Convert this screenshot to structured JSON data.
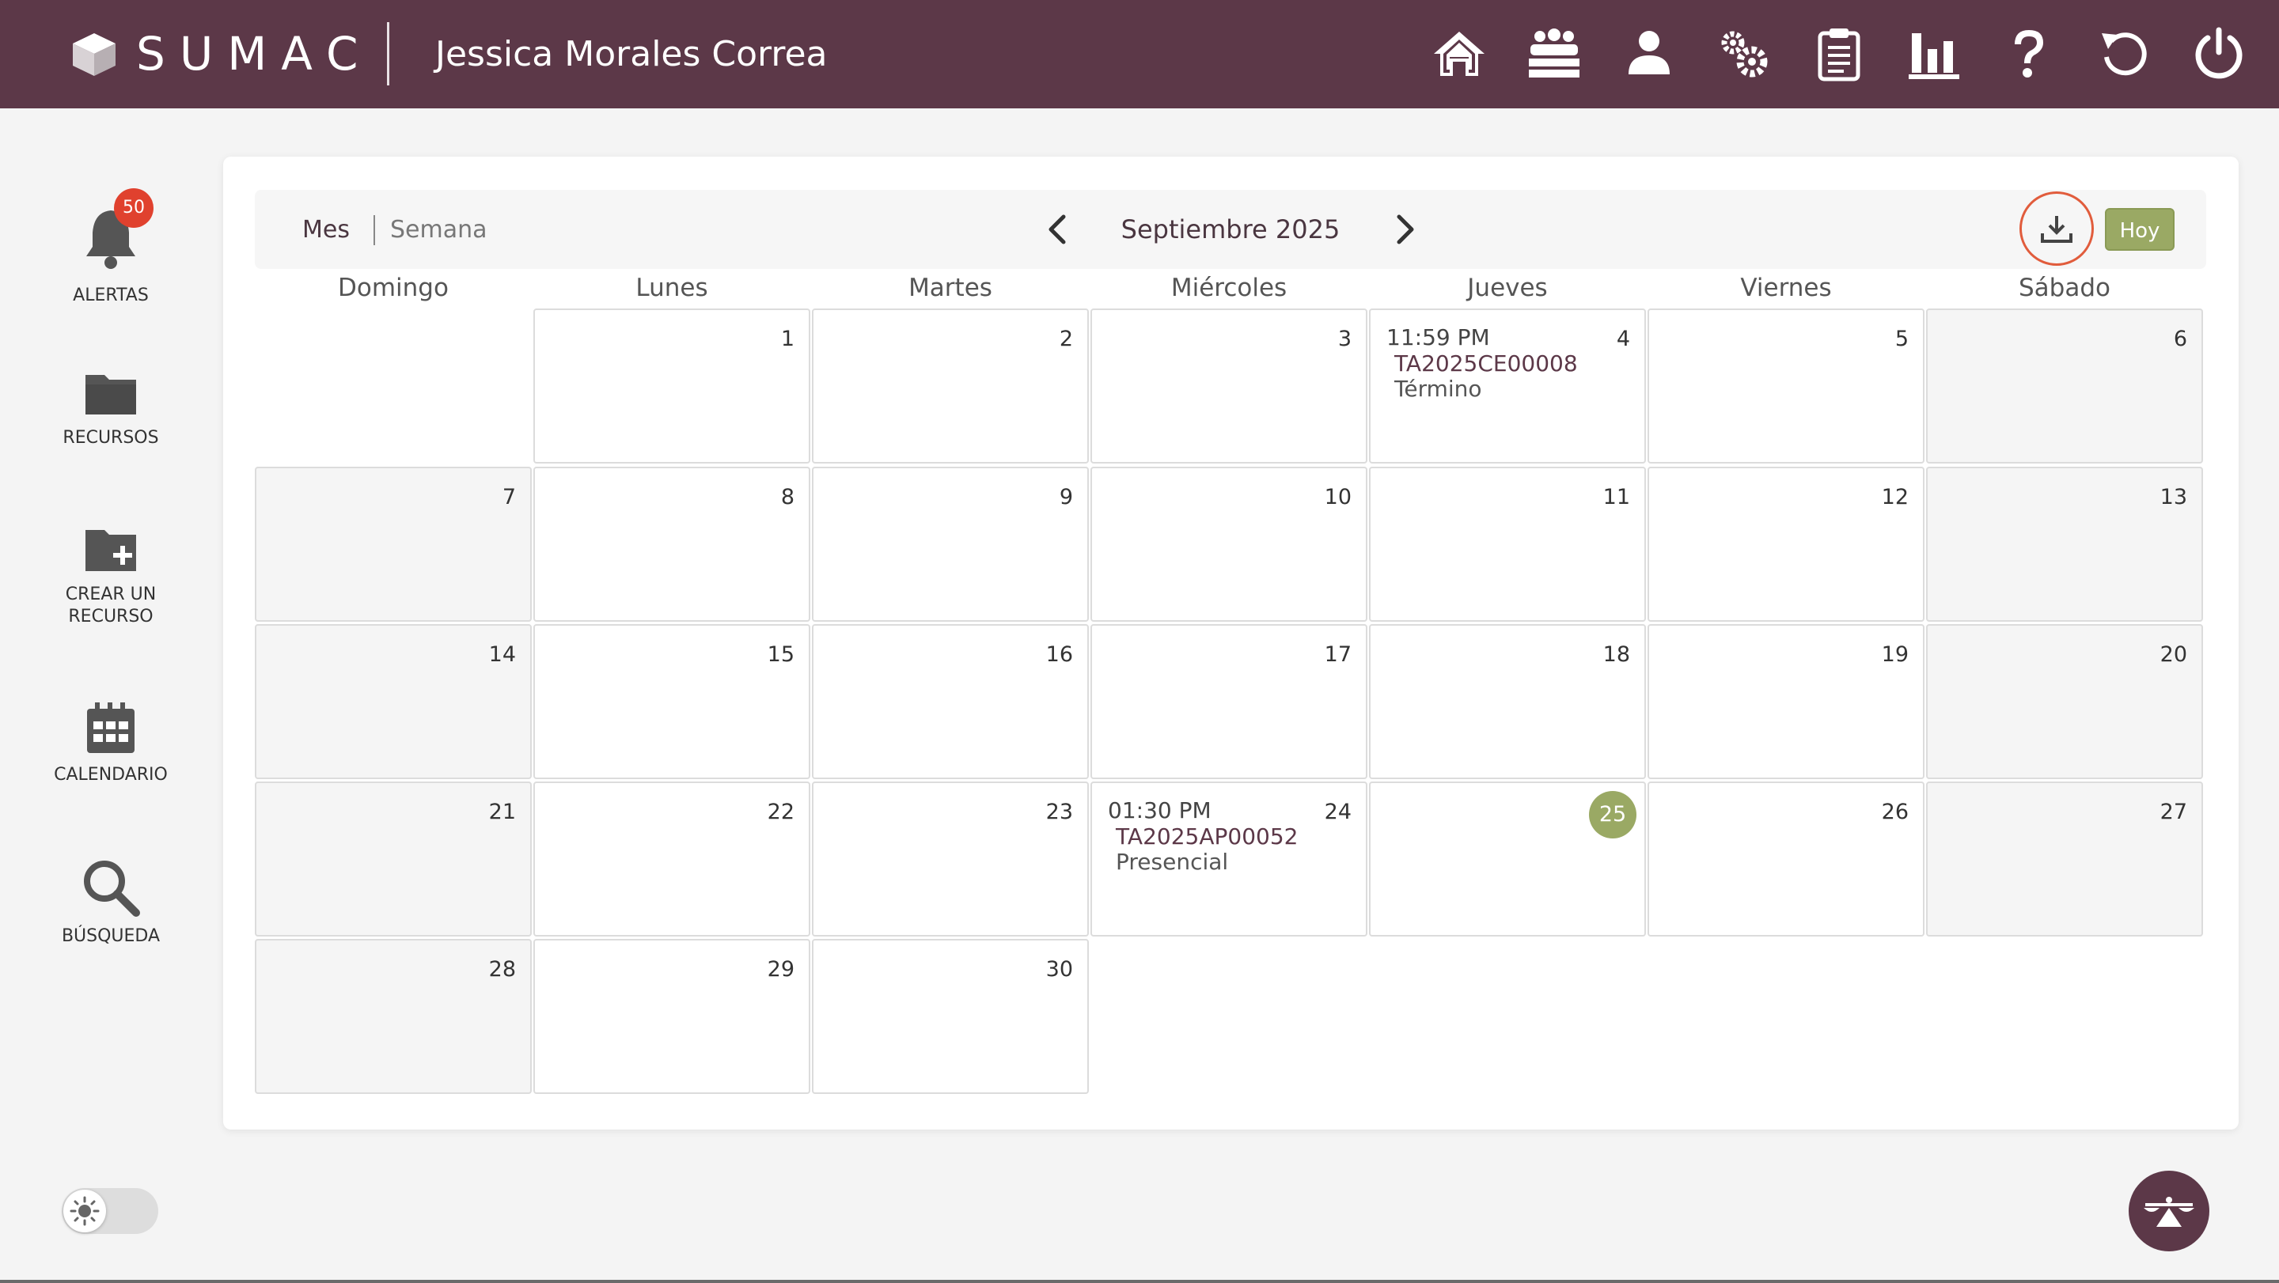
{
  "header": {
    "brand": "SUMAC",
    "user_name": "Jessica Morales Correa",
    "icons": [
      "home-icon",
      "group-icon",
      "user-icon",
      "gears-icon",
      "clipboard-icon",
      "bar-chart-icon",
      "help-icon",
      "refresh-icon",
      "power-icon"
    ]
  },
  "sidebar": {
    "alerts": {
      "label": "ALERTAS",
      "count": "50"
    },
    "resources": {
      "label": "RECURSOS"
    },
    "create_resource": {
      "label_line1": "CREAR UN",
      "label_line2": "RECURSO"
    },
    "calendar": {
      "label": "CALENDARIO"
    },
    "search": {
      "label": "BÚSQUEDA"
    }
  },
  "calendar": {
    "view_month": "Mes",
    "view_week": "Semana",
    "month_title": "Septiembre 2025",
    "today_button": "Hoy",
    "weekdays": [
      "Domingo",
      "Lunes",
      "Martes",
      "Miércoles",
      "Jueves",
      "Viernes",
      "Sábado"
    ],
    "today": "25",
    "days": [
      "1",
      "2",
      "3",
      "4",
      "5",
      "6",
      "7",
      "8",
      "9",
      "10",
      "11",
      "12",
      "13",
      "14",
      "15",
      "16",
      "17",
      "18",
      "19",
      "20",
      "21",
      "22",
      "23",
      "24",
      "25",
      "26",
      "27",
      "28",
      "29",
      "30"
    ],
    "events": [
      {
        "day": "4",
        "time": "11:59 PM",
        "code": "TA2025CE00008",
        "type": "Término"
      },
      {
        "day": "24",
        "time": "01:30 PM",
        "code": "TA2025AP00052",
        "type": "Presencial"
      }
    ]
  },
  "colors": {
    "header_bg": "#5c3848",
    "accent_green": "#9aa964",
    "download_ring": "#e15c3c",
    "badge_red": "#e0412e"
  }
}
